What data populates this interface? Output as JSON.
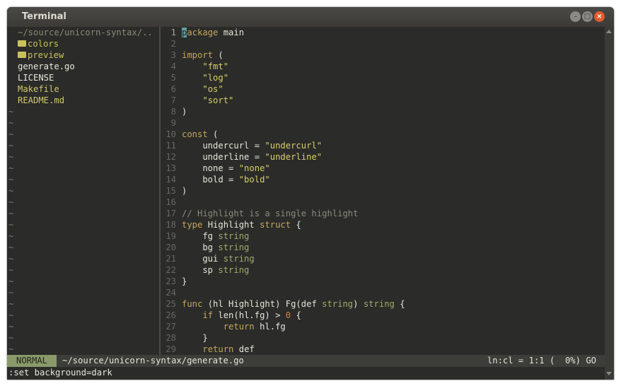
{
  "window": {
    "title": "Terminal"
  },
  "tree": {
    "root": "~/source/unicorn-syntax/..",
    "dirs": [
      "colors",
      "preview"
    ],
    "files": [
      {
        "name": "generate.go",
        "style": "file"
      },
      {
        "name": "LICENSE",
        "style": "file"
      },
      {
        "name": "Makefile",
        "style": "yellow"
      },
      {
        "name": "README.md",
        "style": "yellow"
      }
    ],
    "tilde": "~"
  },
  "code": [
    {
      "n": "1",
      "t": [
        [
          "cur",
          "p"
        ],
        [
          "kw",
          "ackage"
        ],
        [
          "tx",
          " main"
        ]
      ]
    },
    {
      "n": "2",
      "t": []
    },
    {
      "n": "3",
      "t": [
        [
          "kw",
          "import"
        ],
        [
          "tx",
          " ("
        ]
      ]
    },
    {
      "n": "4",
      "t": [
        [
          "tx",
          "    "
        ],
        [
          "st",
          "\"fmt\""
        ]
      ]
    },
    {
      "n": "5",
      "t": [
        [
          "tx",
          "    "
        ],
        [
          "st",
          "\"log\""
        ]
      ]
    },
    {
      "n": "6",
      "t": [
        [
          "tx",
          "    "
        ],
        [
          "st",
          "\"os\""
        ]
      ]
    },
    {
      "n": "7",
      "t": [
        [
          "tx",
          "    "
        ],
        [
          "st",
          "\"sort\""
        ]
      ]
    },
    {
      "n": "8",
      "t": [
        [
          "tx",
          ")"
        ]
      ]
    },
    {
      "n": "9",
      "t": []
    },
    {
      "n": "10",
      "t": [
        [
          "kw",
          "const"
        ],
        [
          "tx",
          " ("
        ]
      ]
    },
    {
      "n": "11",
      "t": [
        [
          "tx",
          "    undercurl = "
        ],
        [
          "st",
          "\"undercurl\""
        ]
      ]
    },
    {
      "n": "12",
      "t": [
        [
          "tx",
          "    underline = "
        ],
        [
          "st",
          "\"underline\""
        ]
      ]
    },
    {
      "n": "13",
      "t": [
        [
          "tx",
          "    none = "
        ],
        [
          "st",
          "\"none\""
        ]
      ]
    },
    {
      "n": "14",
      "t": [
        [
          "tx",
          "    bold = "
        ],
        [
          "st",
          "\"bold\""
        ]
      ]
    },
    {
      "n": "15",
      "t": [
        [
          "tx",
          ")"
        ]
      ]
    },
    {
      "n": "16",
      "t": []
    },
    {
      "n": "17",
      "t": [
        [
          "cm",
          "// Highlight is a single highlight"
        ]
      ]
    },
    {
      "n": "18",
      "t": [
        [
          "kw",
          "type"
        ],
        [
          "tx",
          " Highlight "
        ],
        [
          "kw",
          "struct"
        ],
        [
          "tx",
          " {"
        ]
      ]
    },
    {
      "n": "19",
      "t": [
        [
          "tx",
          "    fg "
        ],
        [
          "ty",
          "string"
        ]
      ]
    },
    {
      "n": "20",
      "t": [
        [
          "tx",
          "    bg "
        ],
        [
          "ty",
          "string"
        ]
      ]
    },
    {
      "n": "21",
      "t": [
        [
          "tx",
          "    gui "
        ],
        [
          "ty",
          "string"
        ]
      ]
    },
    {
      "n": "22",
      "t": [
        [
          "tx",
          "    sp "
        ],
        [
          "ty",
          "string"
        ]
      ]
    },
    {
      "n": "23",
      "t": [
        [
          "tx",
          "}"
        ]
      ]
    },
    {
      "n": "24",
      "t": []
    },
    {
      "n": "25",
      "t": [
        [
          "kw",
          "func"
        ],
        [
          "tx",
          " (hl Highlight) Fg(def "
        ],
        [
          "ty",
          "string"
        ],
        [
          "tx",
          ") "
        ],
        [
          "ty",
          "string"
        ],
        [
          "tx",
          " {"
        ]
      ]
    },
    {
      "n": "26",
      "t": [
        [
          "tx",
          "    "
        ],
        [
          "kw",
          "if"
        ],
        [
          "tx",
          " len(hl.fg) > "
        ],
        [
          "nm",
          "0"
        ],
        [
          "tx",
          " {"
        ]
      ]
    },
    {
      "n": "27",
      "t": [
        [
          "tx",
          "        "
        ],
        [
          "kw",
          "return"
        ],
        [
          "tx",
          " hl.fg"
        ]
      ]
    },
    {
      "n": "28",
      "t": [
        [
          "tx",
          "    }"
        ]
      ]
    },
    {
      "n": "29",
      "t": [
        [
          "tx",
          "    "
        ],
        [
          "kw",
          "return"
        ],
        [
          "tx",
          " def"
        ]
      ]
    }
  ],
  "status": {
    "mode": "NORMAL",
    "file": "~/source/unicorn-syntax/generate.go",
    "position": "ln:cl = 1:1 (  0%) GO"
  },
  "cmdline": ":set background=dark",
  "colors": {
    "accent": "#8a9a6a",
    "keyword": "#c4a75c",
    "string": "#d8cf6a",
    "close_button": "#e25a2d"
  }
}
